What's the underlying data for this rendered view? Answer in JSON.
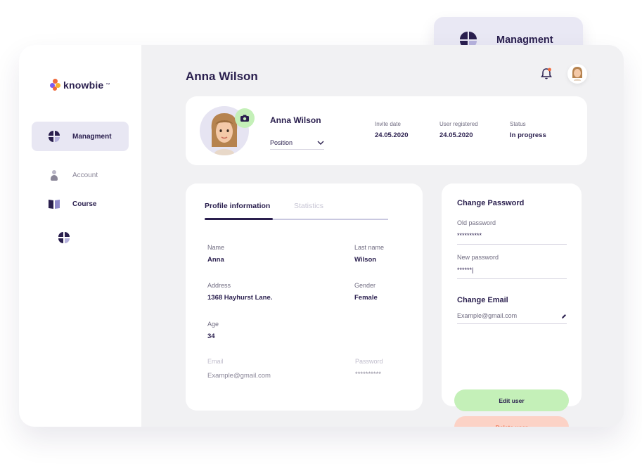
{
  "brand": {
    "name": "knowbie",
    "trademark": "™"
  },
  "sidebar": {
    "items": [
      {
        "label": "Managment",
        "icon": "grid-quad-icon",
        "active": true
      },
      {
        "label": "Account",
        "icon": "user-icon",
        "active": false
      },
      {
        "label": "Course",
        "icon": "book-icon",
        "active": false
      }
    ]
  },
  "header": {
    "title": "Anna Wilson",
    "notification_dot": true
  },
  "profile_header": {
    "name": "Anna Wilson",
    "position_select": "Position",
    "meta": [
      {
        "label": "Invite date",
        "value": "24.05.2020"
      },
      {
        "label": "User registered",
        "value": "24.05.2020"
      },
      {
        "label": "Status",
        "value": "In progress"
      }
    ]
  },
  "profile": {
    "tabs": [
      {
        "label": "Profile information",
        "active": true
      },
      {
        "label": "Statistics",
        "active": false
      }
    ],
    "fields": {
      "name": {
        "label": "Name",
        "value": "Anna"
      },
      "last_name": {
        "label": "Last name",
        "value": "Wilson"
      },
      "address": {
        "label": "Address",
        "value": "1368 Hayhurst Lane."
      },
      "gender": {
        "label": "Gender",
        "value": "Female"
      },
      "age": {
        "label": "Age",
        "value": "34"
      },
      "email": {
        "label": "Email",
        "value": "Example@gmail.com"
      },
      "password": {
        "label": "Password",
        "value": "**********"
      }
    }
  },
  "password_panel": {
    "title": "Change Password",
    "old_password": {
      "label": "Old password",
      "value": "**********"
    },
    "new_password": {
      "label": "New password",
      "value": "******|"
    },
    "email_title": "Change Email",
    "email_value": "Example@gmail.com",
    "edit_button": "Edit user",
    "delete_button": "Delete user"
  },
  "floating_badge": {
    "label": "Managment"
  },
  "colors": {
    "primary": "#2a1f4e",
    "lavender": "#e8e7f3",
    "green": "#c4f0b8",
    "red_soft": "#fcd2c6",
    "red_text": "#f07a5a",
    "background": "#f1f1f3"
  }
}
